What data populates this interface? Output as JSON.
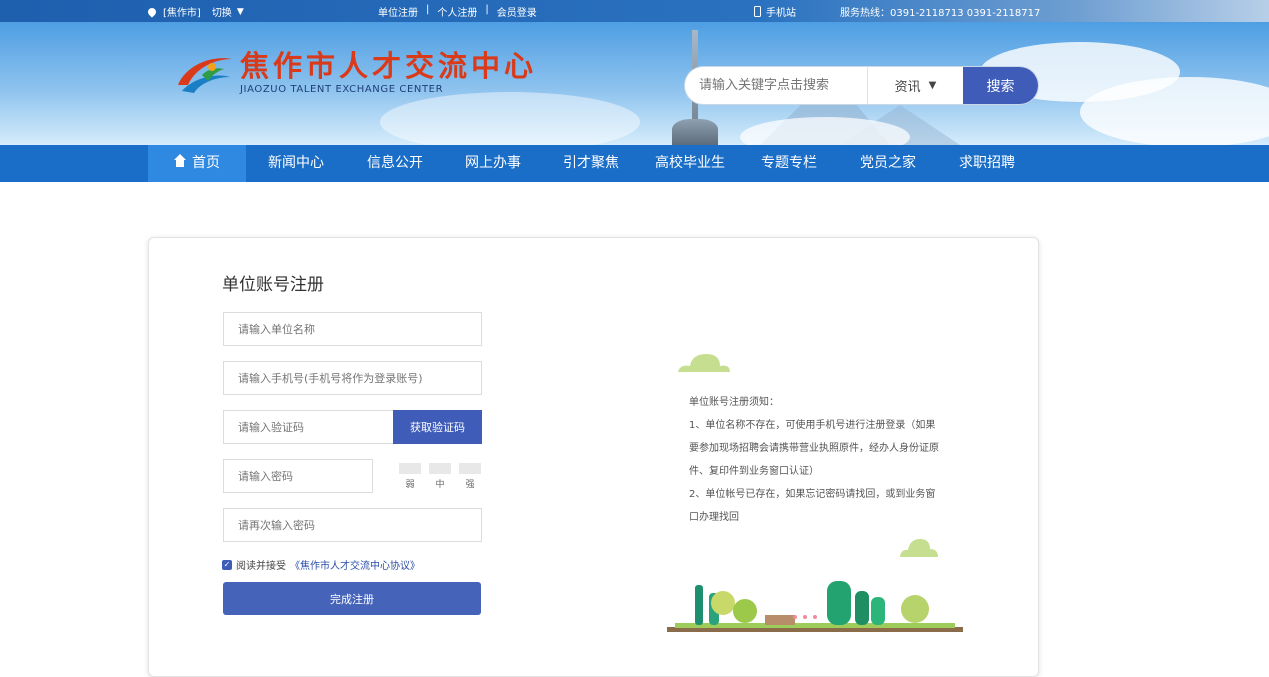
{
  "topbar": {
    "city": "[焦作市]",
    "switch": "切换",
    "links": [
      "单位注册",
      "个人注册",
      "会员登录"
    ],
    "mobile": "手机站",
    "hotline": "服务热线：0391-2118713 0391-2118717"
  },
  "header": {
    "logo_title": "焦作市人才交流中心",
    "logo_sub": "JIAOZUO TALENT EXCHANGE CENTER",
    "search_placeholder": "请输入关键字点击搜索",
    "search_category": "资讯",
    "search_button": "搜索"
  },
  "nav": {
    "items": [
      "首页",
      "新闻中心",
      "信息公开",
      "网上办事",
      "引才聚焦",
      "高校毕业生",
      "专题专栏",
      "党员之家",
      "求职招聘"
    ]
  },
  "form": {
    "title": "单位账号注册",
    "unit_name_placeholder": "请输入单位名称",
    "phone_placeholder": "请输入手机号(手机号将作为登录账号)",
    "code_placeholder": "请输入验证码",
    "code_button": "获取验证码",
    "password_placeholder": "请输入密码",
    "strength": [
      "弱",
      "中",
      "强"
    ],
    "confirm_placeholder": "请再次输入密码",
    "agree_text": "阅读并接受",
    "agree_link": "《焦作市人才交流中心协议》",
    "submit": "完成注册"
  },
  "notice": {
    "title": "单位账号注册须知：",
    "line1": "1、单位名称不存在，可使用手机号进行注册登录（如果要参加现场招聘会请携带营业执照原件，经办人身份证原件、复印件到业务窗口认证）",
    "line2": "2、单位帐号已存在，如果忘记密码请找回，或到业务窗口办理找回"
  },
  "colors": {
    "nav_bg": "#1a6ec8",
    "nav_active": "#3089e0",
    "primary_button": "#3f5cb8",
    "logo_red": "#d93a1a",
    "topbar": "#1e5fae"
  }
}
